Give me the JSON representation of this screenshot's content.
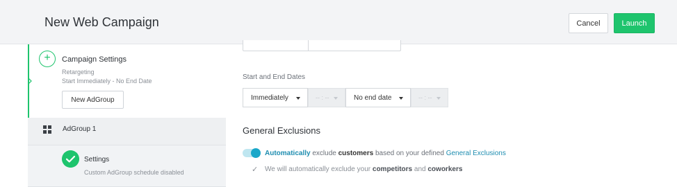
{
  "header": {
    "title": "New Web Campaign",
    "cancel_label": "Cancel",
    "launch_label": "Launch"
  },
  "sidebar": {
    "campaign": {
      "title": "Campaign Settings",
      "type": "Retargeting",
      "schedule": "Start Immediately - No End Date",
      "new_adgroup_label": "New AdGroup"
    },
    "adgroup": {
      "label": "AdGroup 1"
    },
    "settings": {
      "title": "Settings",
      "subtitle": "Custom AdGroup schedule disabled"
    }
  },
  "main": {
    "dates": {
      "label": "Start and End Dates",
      "start_value": "Immediately",
      "start_time_placeholder": "-- : --",
      "end_value": "No end date",
      "end_time_placeholder": "-- : --"
    },
    "exclusions": {
      "title": "General Exclusions",
      "toggle_on": true,
      "line1": {
        "w1": "Automatically",
        "w2": " exclude ",
        "w3": "customers",
        "w4": " based on your defined ",
        "w5": "General Exclusions"
      },
      "line2": {
        "w1": "We will automatically exclude your ",
        "w2": "competitors",
        "w3": " and ",
        "w4": "coworkers"
      }
    }
  },
  "colors": {
    "accent_green": "#1ec46d",
    "link_blue": "#1e8db0",
    "toggle_blue": "#1aa7c9"
  }
}
